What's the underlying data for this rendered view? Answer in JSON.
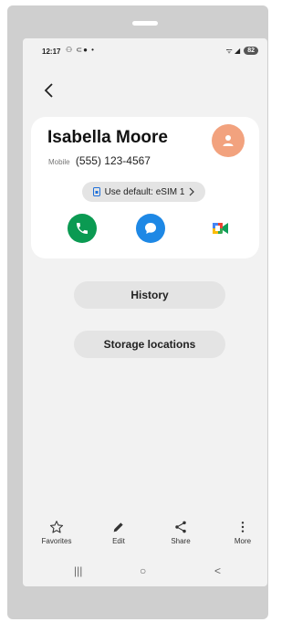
{
  "status_bar": {
    "time": "12:17",
    "indicators": "⚇ ⊂● •",
    "signal": "ᯤ ◢",
    "battery": "82"
  },
  "contact": {
    "name": "Isabella Moore",
    "phone_label": "Mobile",
    "phone_number": "(555) 123-4567",
    "avatar_color": "#f2a27e"
  },
  "sim_selector": {
    "label": "Use default: eSIM 1"
  },
  "actions": [
    {
      "name": "call",
      "icon": "phone-icon",
      "color": "#0b9a52"
    },
    {
      "name": "message",
      "icon": "chat-bubble-icon",
      "color": "#1e88e5"
    },
    {
      "name": "video",
      "icon": "google-meet-icon",
      "color": "#ffffff"
    }
  ],
  "buttons": {
    "history": "History",
    "storage": "Storage locations"
  },
  "bottom_bar": [
    {
      "label": "Favorites",
      "icon": "star-icon"
    },
    {
      "label": "Edit",
      "icon": "pencil-icon"
    },
    {
      "label": "Share",
      "icon": "share-icon"
    },
    {
      "label": "More",
      "icon": "more-vertical-icon"
    }
  ],
  "nav_bar": {
    "recents": "|||",
    "home": "○",
    "back": "<"
  }
}
